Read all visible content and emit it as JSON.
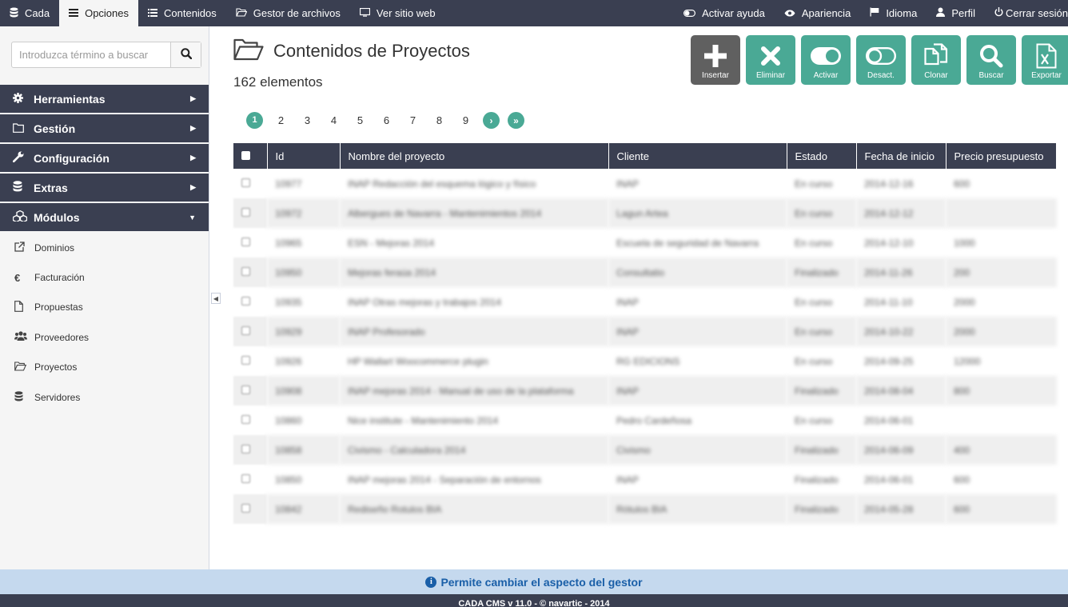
{
  "topbar": {
    "left": [
      {
        "label": "Cada",
        "icon": "database-icon"
      },
      {
        "label": "Opciones",
        "icon": "menu-icon"
      },
      {
        "label": "Contenidos",
        "icon": "list-icon"
      },
      {
        "label": "Gestor de archivos",
        "icon": "folder-icon"
      },
      {
        "label": "Ver sitio web",
        "icon": "monitor-icon"
      }
    ],
    "right": [
      {
        "label": "Activar ayuda",
        "icon": "toggle-icon"
      },
      {
        "label": "Apariencia",
        "icon": "eye-icon"
      },
      {
        "label": "Idioma",
        "icon": "flag-icon"
      },
      {
        "label": "Perfil",
        "icon": "user-icon"
      },
      {
        "label": "Cerrar sesión",
        "icon": "power-icon"
      }
    ]
  },
  "sidebar": {
    "search_placeholder": "Introduzca término a buscar",
    "menu": [
      {
        "label": "Herramientas",
        "icon": "gear-icon"
      },
      {
        "label": "Gestión",
        "icon": "folder-icon"
      },
      {
        "label": "Configuración",
        "icon": "wrench-icon"
      },
      {
        "label": "Extras",
        "icon": "database-icon"
      },
      {
        "label": "Módulos",
        "icon": "cubes-icon"
      }
    ],
    "submenu": [
      {
        "label": "Dominios",
        "icon": "external-link-icon"
      },
      {
        "label": "Facturación",
        "icon": "euro-icon"
      },
      {
        "label": "Propuestas",
        "icon": "file-icon"
      },
      {
        "label": "Proveedores",
        "icon": "users-icon"
      },
      {
        "label": "Proyectos",
        "icon": "folder-open-icon"
      },
      {
        "label": "Servidores",
        "icon": "database-icon"
      }
    ]
  },
  "main": {
    "title": "Contenidos de Proyectos",
    "count": "162 elementos",
    "actions": [
      {
        "label": "Insertar",
        "icon": "plus-icon"
      },
      {
        "label": "Eliminar",
        "icon": "x-icon"
      },
      {
        "label": "Activar",
        "icon": "toggle-on-icon"
      },
      {
        "label": "Desact.",
        "icon": "toggle-off-icon"
      },
      {
        "label": "Clonar",
        "icon": "copy-icon"
      },
      {
        "label": "Buscar",
        "icon": "search-icon"
      },
      {
        "label": "Exportar",
        "icon": "excel-icon"
      }
    ],
    "pages": [
      "1",
      "2",
      "3",
      "4",
      "5",
      "6",
      "7",
      "8",
      "9"
    ],
    "columns": [
      "Id",
      "Nombre del proyecto",
      "Cliente",
      "Estado",
      "Fecha de inicio",
      "Precio presupuesto"
    ],
    "rows": [
      {
        "id": "10977",
        "name": "INAP Redacción del esquema lógico y físico",
        "client": "INAP",
        "status": "En curso",
        "date": "2014-12-16",
        "price": "600"
      },
      {
        "id": "10972",
        "name": "Albergues de Navarra - Mantenimientos 2014",
        "client": "Lagun Artea",
        "status": "En curso",
        "date": "2014-12-12",
        "price": ""
      },
      {
        "id": "10965",
        "name": "ESN - Mejoras 2014",
        "client": "Escuela de seguridad de Navarra",
        "status": "En curso",
        "date": "2014-12-10",
        "price": "1000"
      },
      {
        "id": "10950",
        "name": "Mejoras feraúa 2014",
        "client": "Consultatio",
        "status": "Finalizado",
        "date": "2014-11-26",
        "price": "200"
      },
      {
        "id": "10935",
        "name": "INAP Otras mejoras y trabajos 2014",
        "client": "INAP",
        "status": "En curso",
        "date": "2014-11-10",
        "price": "2000"
      },
      {
        "id": "10929",
        "name": "INAP Profesorado",
        "client": "INAP",
        "status": "En curso",
        "date": "2014-10-22",
        "price": "2000"
      },
      {
        "id": "10926",
        "name": "HP Wallart Woocommerce plugin",
        "client": "RG EDICIONS",
        "status": "En curso",
        "date": "2014-09-25",
        "price": "12000"
      },
      {
        "id": "10908",
        "name": "INAP mejoras 2014 - Manual de uso de la plataforma",
        "client": "INAP",
        "status": "Finalizado",
        "date": "2014-08-04",
        "price": "800"
      },
      {
        "id": "10860",
        "name": "Nice institute - Mantenimiento 2014",
        "client": "Pedro Cardeñosa",
        "status": "En curso",
        "date": "2014-06-01",
        "price": ""
      },
      {
        "id": "10858",
        "name": "Civismo - Calculadora 2014",
        "client": "Civismo",
        "status": "Finalizado",
        "date": "2014-06-09",
        "price": "400"
      },
      {
        "id": "10850",
        "name": "INAP mejoras 2014 - Separación de entornos",
        "client": "INAP",
        "status": "Finalizado",
        "date": "2014-06-01",
        "price": "600"
      },
      {
        "id": "10842",
        "name": "Rediseño Rotulos BIA",
        "client": "Rótulos BIA",
        "status": "Finalizado",
        "date": "2014-05-28",
        "price": "600"
      }
    ]
  },
  "help": {
    "text": "Permite cambiar el aspecto del gestor"
  },
  "footer": {
    "text": "CADA CMS v 11.0 - © navartic - 2014"
  },
  "colors": {
    "dark": "#3a3f51",
    "accent": "#4aa995",
    "help_bg": "#c5d9ee",
    "help_text": "#1a5fa8"
  }
}
